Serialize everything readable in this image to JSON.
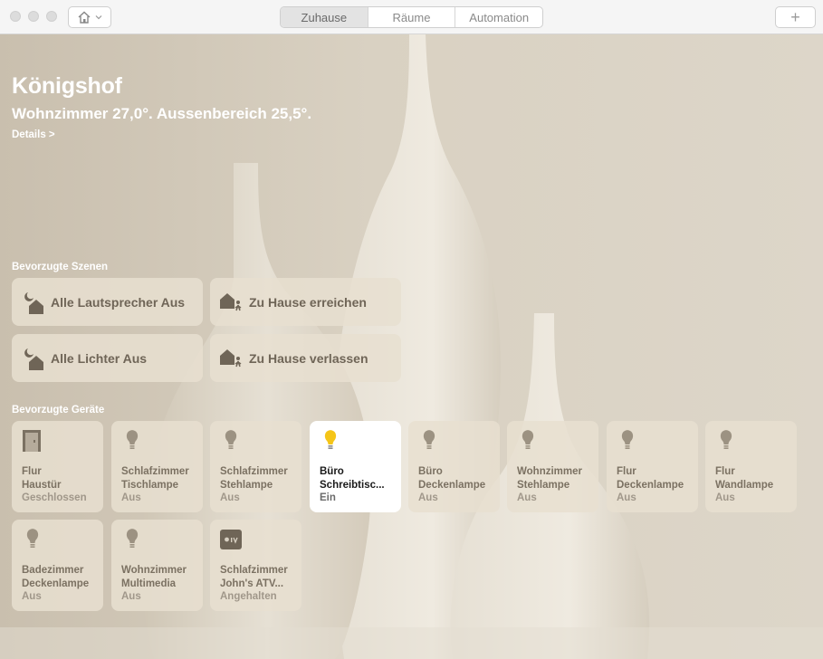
{
  "toolbar": {
    "tabs": [
      "Zuhause",
      "Räume",
      "Automation"
    ],
    "add_label": "+"
  },
  "home": {
    "name": "Königshof",
    "summary": "Wohnzimmer 27,0°. Aussenbereich 25,5°.",
    "details_label": "Details >"
  },
  "scenes": {
    "title": "Bevorzugte Szenen",
    "items": [
      {
        "label": "Alle Lautsprecher Aus",
        "icon": "moon-home-icon"
      },
      {
        "label": "Zu Hause erreichen",
        "icon": "arrive-home-icon"
      },
      {
        "label": "Alle Lichter Aus",
        "icon": "moon-home-icon"
      },
      {
        "label": "Zu Hause verlassen",
        "icon": "leave-home-icon"
      }
    ]
  },
  "devices": {
    "title": "Bevorzugte Geräte",
    "items": [
      {
        "name": "Flur\nHaustür",
        "state": "Geschlossen",
        "icon": "door-icon",
        "on": false
      },
      {
        "name": "Schlafzimmer\nTischlampe",
        "state": "Aus",
        "icon": "bulb-icon",
        "on": false
      },
      {
        "name": "Schlafzimmer\nStehlampe",
        "state": "Aus",
        "icon": "bulb-icon",
        "on": false
      },
      {
        "name": "Büro\nSchreibtisc...",
        "state": "Ein",
        "icon": "bulb-icon",
        "on": true
      },
      {
        "name": "Büro\nDeckenlampe",
        "state": "Aus",
        "icon": "bulb-icon",
        "on": false
      },
      {
        "name": "Wohnzimmer\nStehlampe",
        "state": "Aus",
        "icon": "bulb-icon",
        "on": false
      },
      {
        "name": "Flur\nDeckenlampe",
        "state": "Aus",
        "icon": "bulb-icon",
        "on": false
      },
      {
        "name": "Flur\nWandlampe",
        "state": "Aus",
        "icon": "bulb-icon",
        "on": false
      },
      {
        "name": "Badezimmer\nDeckenlampe",
        "state": "Aus",
        "icon": "bulb-icon",
        "on": false
      },
      {
        "name": "Wohnzimmer\nMultimedia",
        "state": "Aus",
        "icon": "bulb-icon",
        "on": false
      },
      {
        "name": "Schlafzimmer\nJohn's ATV...",
        "state": "Angehalten",
        "icon": "appletv-icon",
        "on": false
      }
    ]
  },
  "colors": {
    "bulb_on": "#f5c518",
    "tile_off": "#e8dfd0",
    "tile_on": "#ffffff"
  }
}
